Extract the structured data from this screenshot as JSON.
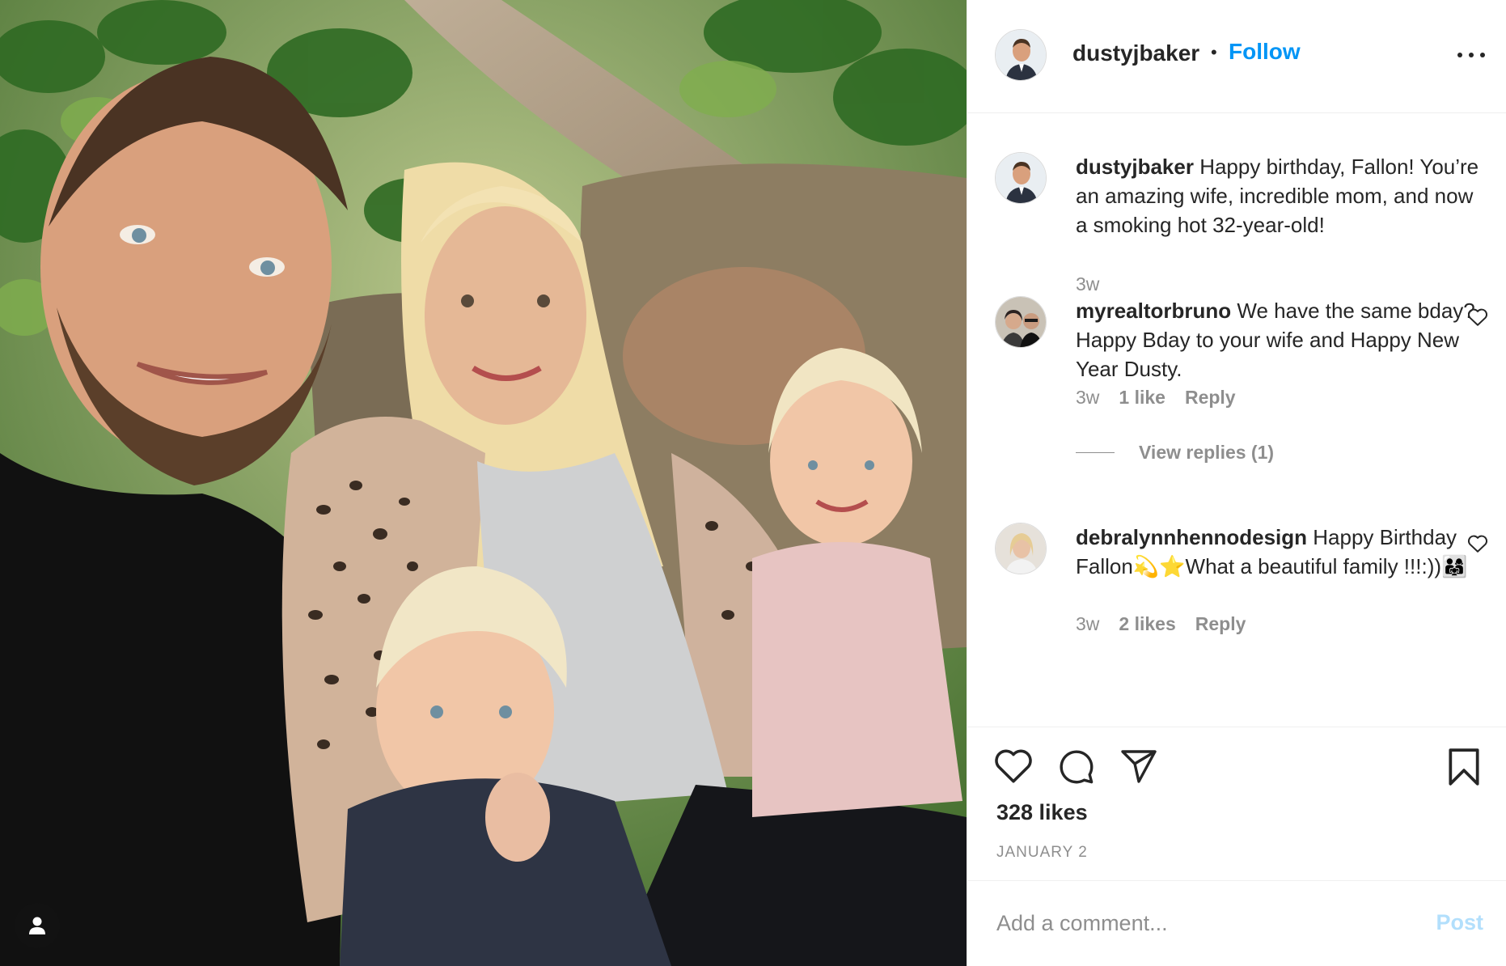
{
  "post": {
    "username": "dustyjbaker",
    "separator": "•",
    "follow_label": "Follow",
    "more_icon": "more-options-icon",
    "tag_icon": "user-tag-icon",
    "caption": {
      "username": "dustyjbaker",
      "text": "Happy birthday, Fallon! You’re an amazing wife, incredible mom, and now a smoking hot 32-year-old!",
      "time": "3w"
    },
    "comments": [
      {
        "username": "myrealtorbruno",
        "text": "We have the same bday? Happy Bday to your wife and Happy New Year Dusty.",
        "time": "3w",
        "likes": "1 like",
        "reply_label": "Reply",
        "view_replies": "View replies (1)"
      },
      {
        "username": "debralynnhennodesign",
        "text": "Happy Birthday Fallon💫⭐What a beautiful family !!!:))👨‍👩‍👧",
        "time": "3w",
        "likes": "2 likes",
        "reply_label": "Reply"
      }
    ],
    "likes_count": "328 likes",
    "date": "JANUARY 2",
    "comment_placeholder": "Add a comment...",
    "post_label": "Post"
  },
  "colors": {
    "link_blue": "#0095f6",
    "post_disabled": "#b2dffc",
    "secondary_text": "#8e8e8e",
    "primary_text": "#262626",
    "divider": "#efefef"
  }
}
